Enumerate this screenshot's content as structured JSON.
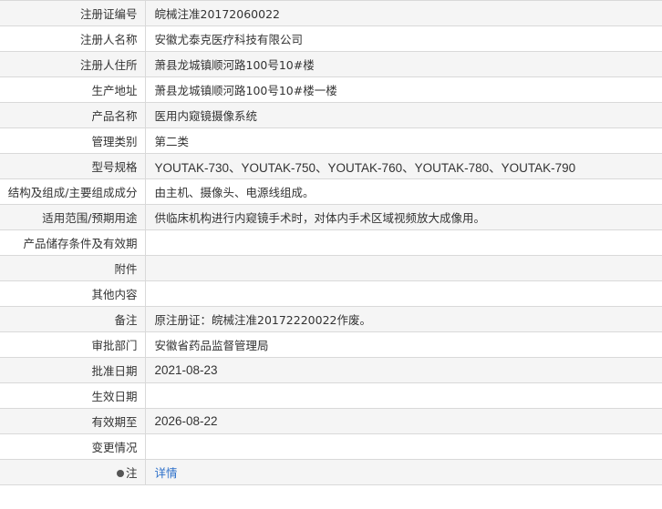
{
  "rows": [
    {
      "label": "注册证编号",
      "value": "皖械注准20172060022"
    },
    {
      "label": "注册人名称",
      "value": "安徽尤泰克医疗科技有限公司"
    },
    {
      "label": "注册人住所",
      "value": "萧县龙城镇顺河路100号10#楼"
    },
    {
      "label": "生产地址",
      "value": "萧县龙城镇顺河路100号10#楼一楼"
    },
    {
      "label": "产品名称",
      "value": "医用内窥镜摄像系统"
    },
    {
      "label": "管理类别",
      "value": "第二类"
    },
    {
      "label": "型号规格",
      "value": "YOUTAK-730、YOUTAK-750、YOUTAK-760、YOUTAK-780、YOUTAK-790"
    },
    {
      "label": "结构及组成/主要组成成分",
      "value": "由主机、摄像头、电源线组成。"
    },
    {
      "label": "适用范围/预期用途",
      "value": "供临床机构进行内窥镜手术时，对体内手术区域视频放大成像用。"
    },
    {
      "label": "产品储存条件及有效期",
      "value": ""
    },
    {
      "label": "附件",
      "value": ""
    },
    {
      "label": "其他内容",
      "value": ""
    },
    {
      "label": "备注",
      "value": "原注册证：皖械注准20172220022作废。"
    },
    {
      "label": "审批部门",
      "value": "安徽省药品监督管理局"
    },
    {
      "label": "批准日期",
      "value": "2021-08-23"
    },
    {
      "label": "生效日期",
      "value": ""
    },
    {
      "label": "有效期至",
      "value": "2026-08-22"
    },
    {
      "label": "变更情况",
      "value": ""
    }
  ],
  "note_row": {
    "label": "注",
    "icon": "note-icon",
    "link_text": "详情"
  }
}
